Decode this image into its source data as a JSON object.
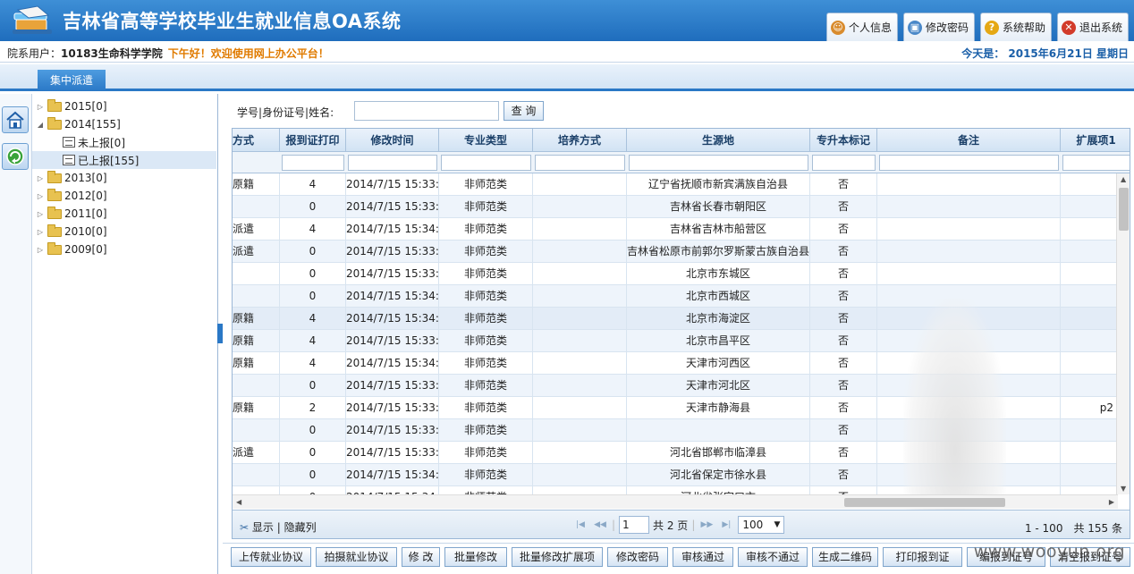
{
  "header": {
    "title": "吉林省高等学校毕业生就业信息OA系统",
    "buttons": [
      "个人信息",
      "修改密码",
      "系统帮助",
      "退出系统"
    ]
  },
  "userbar": {
    "label": "院系用户：",
    "user": "10183生命科学学院",
    "greeting": "下午好！欢迎使用网上办公平台！",
    "date": "今天是： 2015年6月21日 星期日"
  },
  "tabs": [
    "集中派遣"
  ],
  "tree": [
    {
      "label": "2015[0]",
      "expanded": false
    },
    {
      "label": "2014[155]",
      "expanded": true
    },
    {
      "label": "未上报[0]",
      "leaf": true
    },
    {
      "label": "已上报[155]",
      "leaf": true,
      "selected": true
    },
    {
      "label": "2013[0]",
      "expanded": false
    },
    {
      "label": "2012[0]",
      "expanded": false
    },
    {
      "label": "2011[0]",
      "expanded": false
    },
    {
      "label": "2010[0]",
      "expanded": false
    },
    {
      "label": "2009[0]",
      "expanded": false
    }
  ],
  "search": {
    "label": "学号|身份证号|姓名:",
    "value": "",
    "button": "查 询"
  },
  "grid": {
    "columns": [
      "方式",
      "报到证打印",
      "修改时间",
      "专业类型",
      "培养方式",
      "生源地",
      "专升本标记",
      "备注",
      "扩展项1"
    ],
    "rows": [
      [
        "原籍",
        "4",
        "2014/7/15 15:33:5",
        "非师范类",
        "",
        "辽宁省抚顺市新宾满族自治县",
        "否",
        "",
        ""
      ],
      [
        "",
        "0",
        "2014/7/15 15:33:5",
        "非师范类",
        "",
        "吉林省长春市朝阳区",
        "否",
        "",
        ""
      ],
      [
        "派遣",
        "4",
        "2014/7/15 15:34:0",
        "非师范类",
        "",
        "吉林省吉林市船营区",
        "否",
        "",
        ""
      ],
      [
        "派遣",
        "0",
        "2014/7/15 15:33:5",
        "非师范类",
        "",
        "吉林省松原市前郭尔罗斯蒙古族自治县",
        "否",
        "",
        ""
      ],
      [
        "",
        "0",
        "2014/7/15 15:33:5",
        "非师范类",
        "",
        "北京市东城区",
        "否",
        "",
        ""
      ],
      [
        "",
        "0",
        "2014/7/15 15:34:0",
        "非师范类",
        "",
        "北京市西城区",
        "否",
        "",
        ""
      ],
      [
        "原籍",
        "4",
        "2014/7/15 15:34:0",
        "非师范类",
        "",
        "北京市海淀区",
        "否",
        "",
        ""
      ],
      [
        "原籍",
        "4",
        "2014/7/15 15:33:5",
        "非师范类",
        "",
        "北京市昌平区",
        "否",
        "",
        ""
      ],
      [
        "原籍",
        "4",
        "2014/7/15 15:34:0",
        "非师范类",
        "",
        "天津市河西区",
        "否",
        "",
        ""
      ],
      [
        "",
        "0",
        "2014/7/15 15:33:5",
        "非师范类",
        "",
        "天津市河北区",
        "否",
        "",
        ""
      ],
      [
        "原籍",
        "2",
        "2014/7/15 15:33:5",
        "非师范类",
        "",
        "天津市静海县",
        "否",
        "",
        "p2"
      ],
      [
        "",
        "0",
        "2014/7/15 15:33:5",
        "非师范类",
        "",
        "",
        "否",
        "",
        ""
      ],
      [
        "派遣",
        "0",
        "2014/7/15 15:33:5",
        "非师范类",
        "",
        "河北省邯郸市临漳县",
        "否",
        "",
        ""
      ],
      [
        "",
        "0",
        "2014/7/15 15:34:0",
        "非师范类",
        "",
        "河北省保定市徐水县",
        "否",
        "",
        ""
      ],
      [
        "",
        "0",
        "2014/7/15 15:34:0",
        "非师范类",
        "",
        "河北省张家口市",
        "否",
        "",
        ""
      ]
    ]
  },
  "pager": {
    "show": "显示",
    "hide": "隐藏列",
    "page": "1",
    "total_pages": "共 2 页",
    "page_size": "100",
    "info": "1 - 100　共 155 条"
  },
  "actions": [
    "上传就业协议",
    "拍摄就业协议",
    "修 改",
    "批量修改",
    "批量修改扩展项",
    "修改密码",
    "审核通过",
    "审核不通过",
    "生成二维码",
    "打印报到证",
    "编报到证号",
    "清空报到证号"
  ],
  "watermark": "www.wooyun.org"
}
